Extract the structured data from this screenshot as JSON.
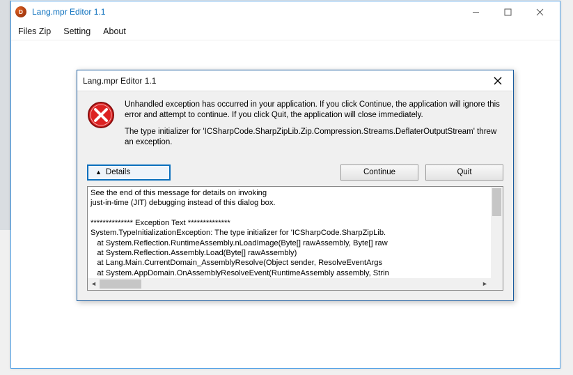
{
  "main_window": {
    "title": "Lang.mpr Editor 1.1",
    "menu": {
      "files_zip": "Files Zip",
      "setting": "Setting",
      "about": "About"
    }
  },
  "dialog": {
    "title": "Lang.mpr Editor 1.1",
    "msg1": "Unhandled exception has occurred in your application. If you click Continue, the application will ignore this error and attempt to continue. If you click Quit, the application will close immediately.",
    "msg2": "The type initializer for 'ICSharpCode.SharpZipLib.Zip.Compression.Streams.DeflaterOutputStream' threw an exception.",
    "buttons": {
      "details": "Details",
      "continue": "Continue",
      "quit": "Quit"
    },
    "details_text": "See the end of this message for details on invoking\njust-in-time (JIT) debugging instead of this dialog box.\n\n************** Exception Text **************\nSystem.TypeInitializationException: The type initializer for 'ICSharpCode.SharpZipLib.\n   at System.Reflection.RuntimeAssembly.nLoadImage(Byte[] rawAssembly, Byte[] raw\n   at System.Reflection.Assembly.Load(Byte[] rawAssembly)\n   at Lang.Main.CurrentDomain_AssemblyResolve(Object sender, ResolveEventArgs\n   at System.AppDomain.OnAssemblyResolveEvent(RuntimeAssembly assembly, Strin\n   --- End of inner exception stack trace ---"
  }
}
